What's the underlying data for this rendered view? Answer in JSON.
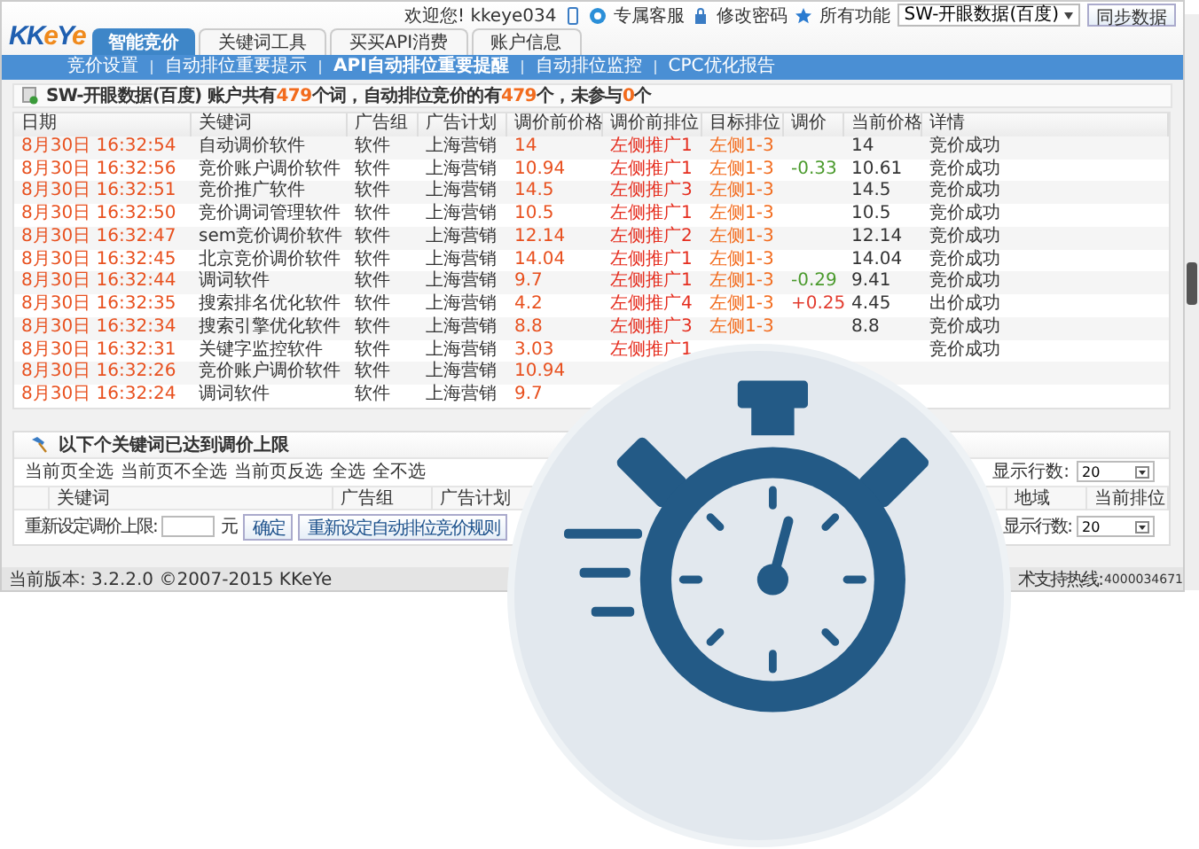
{
  "logo": {
    "parts": [
      {
        "text": "KK",
        "color": "#1f5fb0"
      },
      {
        "text": "e",
        "color": "#f08a1c"
      },
      {
        "text": "Y",
        "color": "#1f5fb0"
      },
      {
        "text": "e",
        "color": "#f08a1c"
      }
    ]
  },
  "tabs": [
    {
      "label": "智能竞价",
      "selected": true
    },
    {
      "label": "关键词工具",
      "selected": false
    },
    {
      "label": "买买API消费",
      "selected": false
    },
    {
      "label": "账户信息",
      "selected": false
    }
  ],
  "user_bar": {
    "welcome": "欢迎您! kkeye034",
    "service": "专属客服",
    "password": "修改密码",
    "features": "所有功能",
    "account": "SW-开眼数据(百度)",
    "sync": "同步数据"
  },
  "subnav": [
    {
      "label": "竞价设置",
      "selected": false
    },
    {
      "label": "自动排位重要提示",
      "selected": false
    },
    {
      "label": "API自动排位重要提醒",
      "selected": true
    },
    {
      "label": "自动排位监控",
      "selected": false
    },
    {
      "label": "CPC优化报告",
      "selected": false
    }
  ],
  "summary": [
    {
      "text": "SW-开眼数据(百度) 账户共有",
      "highlight": false
    },
    {
      "text": "479",
      "highlight": true
    },
    {
      "text": "个词，自动排位竞价的有",
      "highlight": false
    },
    {
      "text": "479",
      "highlight": true
    },
    {
      "text": "个，未参与",
      "highlight": false
    },
    {
      "text": "0",
      "highlight": true
    },
    {
      "text": "个",
      "highlight": false
    }
  ],
  "table": {
    "columns": [
      "日期",
      "关键词",
      "广告组",
      "广告计划",
      "调价前价格",
      "调价前排位",
      "目标排位",
      "调价",
      "当前价格",
      "详情"
    ],
    "rows": [
      {
        "date": "8月30日 16:32:54",
        "keyword": "自动调价软件",
        "group": "软件",
        "plan": "上海营销",
        "old_price": "14",
        "old_rank": "左侧推广1",
        "target": "左侧1-3",
        "change": null,
        "price": "14",
        "detail": "竞价成功"
      },
      {
        "date": "8月30日 16:32:56",
        "keyword": "竞价账户调价软件",
        "group": "软件",
        "plan": "上海营销",
        "old_price": "10.94",
        "old_rank": "左侧推广1",
        "target": "左侧1-3",
        "change": "-0.33",
        "rising": false,
        "price": "10.61",
        "detail": "竞价成功"
      },
      {
        "date": "8月30日 16:32:51",
        "keyword": "竞价推广软件",
        "group": "软件",
        "plan": "上海营销",
        "old_price": "14.5",
        "old_rank": "左侧推广3",
        "target": "左侧1-3",
        "change": null,
        "price": "14.5",
        "detail": "竞价成功"
      },
      {
        "date": "8月30日 16:32:50",
        "keyword": "竞价调词管理软件",
        "group": "软件",
        "plan": "上海营销",
        "old_price": "10.5",
        "old_rank": "左侧推广1",
        "target": "左侧1-3",
        "change": null,
        "price": "10.5",
        "detail": "竞价成功"
      },
      {
        "date": "8月30日 16:32:47",
        "keyword": "sem竞价调价软件",
        "group": "软件",
        "plan": "上海营销",
        "old_price": "12.14",
        "old_rank": "左侧推广2",
        "target": "左侧1-3",
        "change": null,
        "price": "12.14",
        "detail": "竞价成功"
      },
      {
        "date": "8月30日 16:32:45",
        "keyword": "北京竞价调价软件",
        "group": "软件",
        "plan": "上海营销",
        "old_price": "14.04",
        "old_rank": "左侧推广1",
        "target": "左侧1-3",
        "change": null,
        "price": "14.04",
        "detail": "竞价成功"
      },
      {
        "date": "8月30日 16:32:44",
        "keyword": "调词软件",
        "group": "软件",
        "plan": "上海营销",
        "old_price": "9.7",
        "old_rank": "左侧推广1",
        "target": "左侧1-3",
        "change": "-0.29",
        "rising": false,
        "price": "9.41",
        "detail": "竞价成功"
      },
      {
        "date": "8月30日 16:32:35",
        "keyword": "搜索排名优化软件",
        "group": "软件",
        "plan": "上海营销",
        "old_price": "4.2",
        "old_rank": "左侧推广4",
        "target": "左侧1-3",
        "change": "+0.25",
        "rising": true,
        "price": "4.45",
        "detail": "出价成功"
      },
      {
        "date": "8月30日 16:32:34",
        "keyword": "搜索引擎优化软件",
        "group": "软件",
        "plan": "上海营销",
        "old_price": "8.8",
        "old_rank": "左侧推广3",
        "target": "左侧1-3",
        "change": null,
        "price": "8.8",
        "detail": "竞价成功"
      },
      {
        "date": "8月30日 16:32:31",
        "keyword": "关键字监控软件",
        "group": "软件",
        "plan": "上海营销",
        "old_price": "3.03",
        "old_rank": "左侧推广1",
        "target": null,
        "change": null,
        "price": null,
        "detail": "竞价成功"
      },
      {
        "date": "8月30日 16:32:26",
        "keyword": "竞价账户调价软件",
        "group": "软件",
        "plan": "上海营销",
        "old_price": "10.94",
        "old_rank": null,
        "target": null,
        "change": null,
        "price": null,
        "detail": null
      },
      {
        "date": "8月30日 16:32:24",
        "keyword": "调词软件",
        "group": "软件",
        "plan": "上海营销",
        "old_price": "9.7",
        "old_rank": null,
        "target": null,
        "change": null,
        "price": null,
        "detail": null
      }
    ]
  },
  "limit_panel": {
    "title": "以下个关键词已达到调价上限",
    "links": [
      "当前页全选",
      "当前页不全选",
      "当前页反选",
      "全选",
      "全不选"
    ],
    "rows_label": "显示行数:",
    "rows_value": "20",
    "columns": [
      "关键词",
      "广告组",
      "广告计划",
      "地域",
      "当前排位"
    ],
    "reset_label": "重新设定调价上限:",
    "unit": "元",
    "confirm": "确定",
    "reset_rule": "重新设定自动排位竞价规则",
    "rows_label_2": "显示行数:",
    "rows_value_2": "20"
  },
  "status_bar": {
    "version": "当前版本: 3.2.2.0 ©2007-2015 KKeYe",
    "hotline_label": "术支持热线:",
    "hotline_number": "4000034671"
  }
}
